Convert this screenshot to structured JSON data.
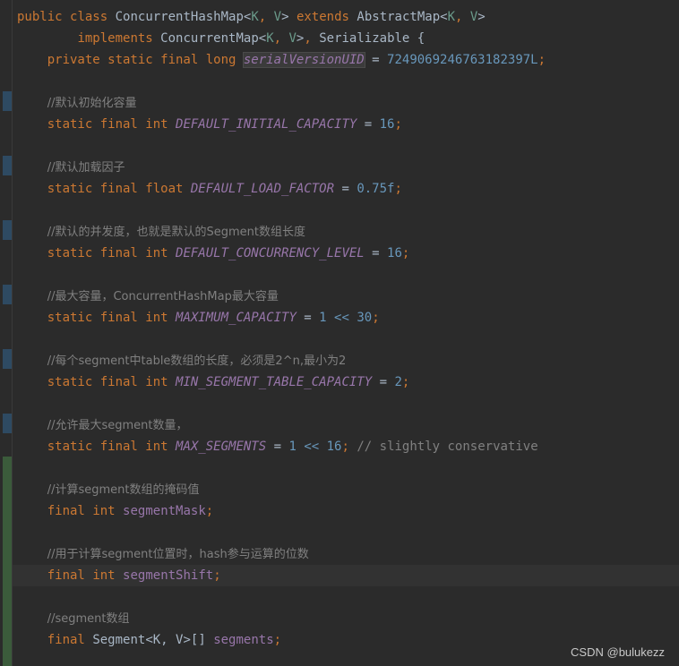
{
  "code": {
    "line1": [
      "public",
      "class",
      "ConcurrentHashMap",
      "<",
      "K",
      ", ",
      "V",
      ">",
      "extends",
      "AbstractMap",
      "<",
      "K",
      ", ",
      "V",
      ">"
    ],
    "class_decl": {
      "kw_public": "public",
      "kw_class": "class",
      "name": "ConcurrentHashMap",
      "type_params": [
        "K",
        "V"
      ],
      "kw_extends": "extends",
      "super": "AbstractMap",
      "kw_implements": "implements",
      "interfaces": [
        "ConcurrentMap",
        "Serializable"
      ]
    },
    "serial": {
      "mods": "private static final long",
      "name": "serialVersionUID",
      "value": "7249069246763182397L"
    },
    "fields": [
      {
        "comment": "//默认初始化容量",
        "mods": "static final int",
        "name": "DEFAULT_INITIAL_CAPACITY",
        "value": "16",
        "tail": ""
      },
      {
        "comment": "//默认加载因子",
        "mods": "static final float",
        "name": "DEFAULT_LOAD_FACTOR",
        "value": "0.75f",
        "tail": ""
      },
      {
        "comment": "//默认的并发度，也就是默认的Segment数组长度",
        "mods": "static final int",
        "name": "DEFAULT_CONCURRENCY_LEVEL",
        "value": "16",
        "tail": ""
      },
      {
        "comment": "//最大容量，ConcurrentHashMap最大容量",
        "mods": "static final int",
        "name": "MAXIMUM_CAPACITY",
        "value": "1 << 30",
        "tail": ""
      },
      {
        "comment": "//每个segment中table数组的长度，必须是2^n,最小为2",
        "mods": "static final int",
        "name": "MIN_SEGMENT_TABLE_CAPACITY",
        "value": "2",
        "tail": ""
      },
      {
        "comment": "//允许最大segment数量，",
        "mods": "static final int",
        "name": "MAX_SEGMENTS",
        "value": "1 << 16",
        "tail": "// slightly conservative"
      }
    ],
    "instance_fields": [
      {
        "comment": "//计算segment数组的掩码值",
        "mods": "final",
        "type": "int",
        "name": "segmentMask"
      },
      {
        "comment": "//用于计算segment位置时，hash参与运算的位数",
        "mods": "final",
        "type": "int",
        "name": "segmentShift"
      },
      {
        "comment": "//segment数组",
        "mods": "final",
        "type": "Segment<K, V>[]",
        "name": "segments"
      }
    ]
  },
  "watermark": "CSDN @bulukezz"
}
